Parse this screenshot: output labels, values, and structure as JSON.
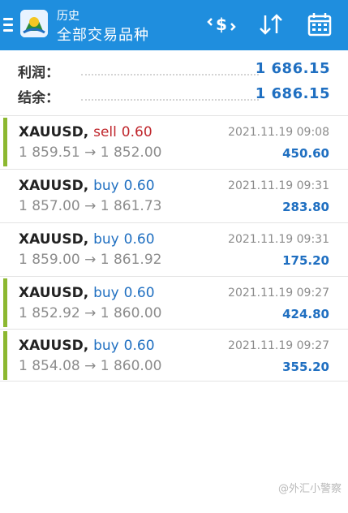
{
  "header": {
    "subtitle": "历史",
    "title": "全部交易品种"
  },
  "summary": {
    "profit_label": "利润：",
    "profit_value": "1 686.15",
    "balance_label": "结余：",
    "balance_value": "1 686.15"
  },
  "deals": [
    {
      "symbol": "XAUUSD,",
      "side": "sell",
      "volume": "0.60",
      "open": "1 859.51",
      "arrow": "→",
      "close": "1 852.00",
      "time": "2021.11.19 09:08",
      "profit": "450.60"
    },
    {
      "symbol": "XAUUSD,",
      "side": "buy",
      "volume": "0.60",
      "open": "1 857.00",
      "arrow": "→",
      "close": "1 861.73",
      "time": "2021.11.19 09:31",
      "profit": "283.80"
    },
    {
      "symbol": "XAUUSD,",
      "side": "buy",
      "volume": "0.60",
      "open": "1 859.00",
      "arrow": "→",
      "close": "1 861.92",
      "time": "2021.11.19 09:31",
      "profit": "175.20"
    },
    {
      "symbol": "XAUUSD,",
      "side": "buy",
      "volume": "0.60",
      "open": "1 852.92",
      "arrow": "→",
      "close": "1 860.00",
      "time": "2021.11.19 09:27",
      "profit": "424.80"
    },
    {
      "symbol": "XAUUSD,",
      "side": "buy",
      "volume": "0.60",
      "open": "1 854.08",
      "arrow": "→",
      "close": "1 860.00",
      "time": "2021.11.19 09:27",
      "profit": "355.20"
    }
  ],
  "watermark": "@外汇小警察",
  "icons": {
    "menu": "hamburger-icon",
    "logo": "metatrader-logo",
    "sort_money": "dollar-sort-icon",
    "sort": "sort-arrows-icon",
    "calendar": "calendar-icon"
  },
  "colors": {
    "header": "#1f8ede",
    "profit": "#1f6fc1",
    "sell": "#c0272d",
    "buy": "#1f6fc1",
    "marker": "#8cb830"
  }
}
